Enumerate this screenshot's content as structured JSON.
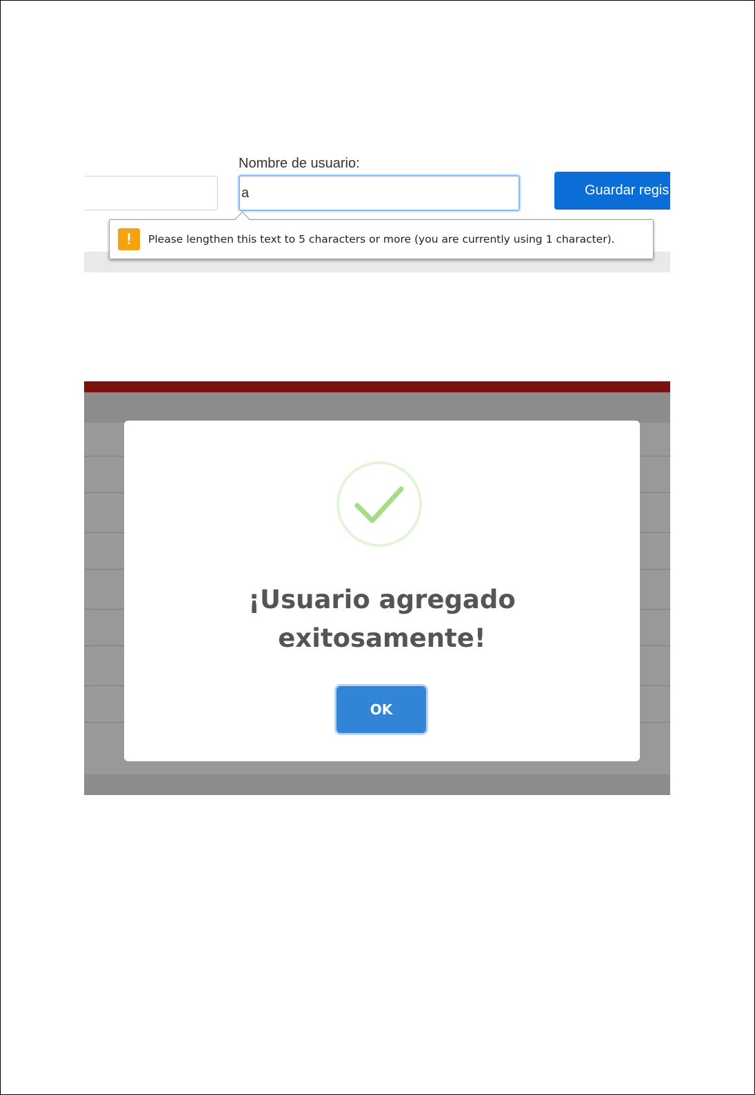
{
  "validation_panel": {
    "username_label": "Nombre de usuario:",
    "username_value": "a",
    "save_button_label": "Guardar regis",
    "tooltip_icon": "warning-icon",
    "tooltip_icon_glyph": "!",
    "tooltip_text": "Please lengthen this text to 5 characters or more (you are currently using 1 character).",
    "colors": {
      "save_button": "#0b6ed6",
      "warning": "#f4a20d",
      "input_focus": "#8ab8f0"
    }
  },
  "success_modal": {
    "icon": "success-check-icon",
    "title_line1": "¡Usuario agregado",
    "title_line2": "exitosamente!",
    "ok_button_label": "OK",
    "colors": {
      "header_bar": "#7a1212",
      "overlay": "#999999",
      "check": "#a5dc86",
      "ok_button": "#3184d6"
    }
  }
}
